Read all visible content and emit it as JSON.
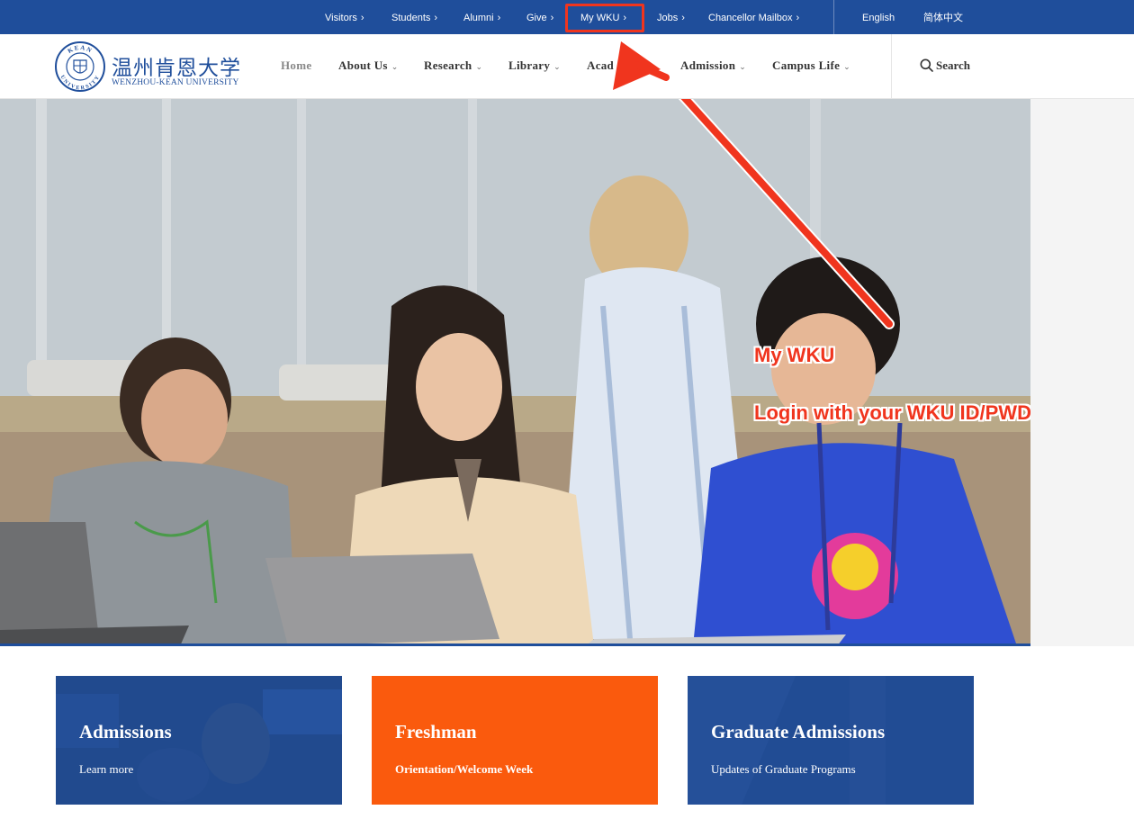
{
  "topbar": {
    "links": [
      {
        "label": "Visitors",
        "chevron": "›"
      },
      {
        "label": "Students",
        "chevron": "›"
      },
      {
        "label": "Alumni",
        "chevron": "›"
      },
      {
        "label": "Give",
        "chevron": "›"
      },
      {
        "label": "My WKU",
        "chevron": "›"
      },
      {
        "label": "Jobs",
        "chevron": "›"
      },
      {
        "label": "Chancellor Mailbox",
        "chevron": "›"
      }
    ],
    "languages": [
      "English",
      "简体中文"
    ]
  },
  "header": {
    "logo": {
      "seal_top": "KEAN",
      "seal_bottom": "UNIVERSITY",
      "cn": "温州肯恩大学",
      "en": "WENZHOU-KEAN UNIVERSITY"
    },
    "nav": [
      {
        "label": "Home",
        "has_dropdown": false
      },
      {
        "label": "About Us",
        "has_dropdown": true
      },
      {
        "label": "Research",
        "has_dropdown": true
      },
      {
        "label": "Library",
        "has_dropdown": true
      },
      {
        "label": "Academics",
        "has_dropdown": true
      },
      {
        "label": "Admission",
        "has_dropdown": true
      },
      {
        "label": "Campus Life",
        "has_dropdown": true
      }
    ],
    "caret": "⌄",
    "search_label": "Search"
  },
  "hero": {
    "image": "students-with-laptops-and-instructor-photo"
  },
  "annotation": {
    "color": "#f0351e",
    "line1": "My WKU",
    "line2": "Login with your WKU ID/PWD"
  },
  "cards": [
    {
      "title": "Admissions",
      "subtitle": "Learn more",
      "color": "#1f4e9b"
    },
    {
      "title": "Freshman",
      "subtitle": "Orientation/Welcome Week",
      "color": "#fa5a0d"
    },
    {
      "title": "Graduate Admissions",
      "subtitle": "Updates of Graduate Programs",
      "color": "#1f4e9b"
    }
  ],
  "colors": {
    "brand_blue": "#1f4e9b",
    "accent_orange": "#fa5a0d",
    "annotation_red": "#f0351e"
  }
}
